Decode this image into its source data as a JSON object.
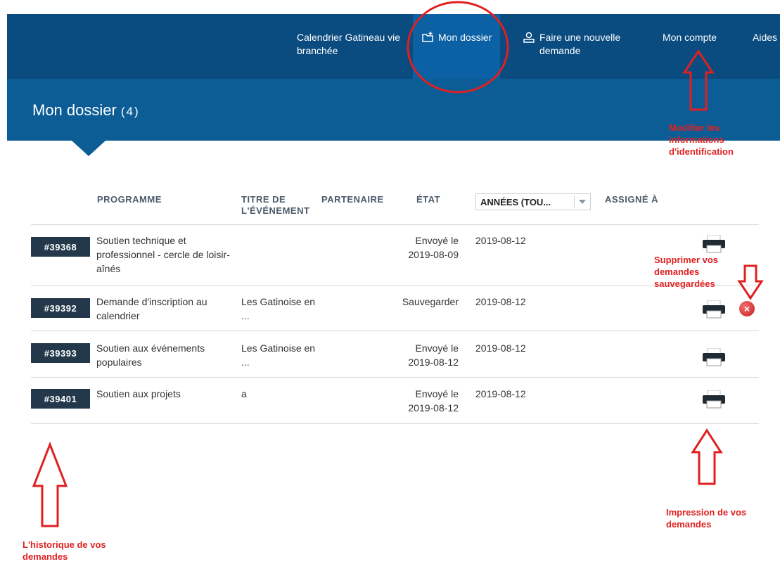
{
  "nav": {
    "calendar_label": "Calendrier Gatineau vie branchée",
    "dossier_label": "Mon dossier",
    "new_request_label": "Faire une nouvelle demande",
    "account_label": "Mon compte",
    "help_label": "Aides"
  },
  "banner": {
    "title": "Mon dossier",
    "count": "(4)"
  },
  "table": {
    "headers": {
      "programme": "PROGRAMME",
      "titre": "TITRE DE L'ÉVÉNEMENT",
      "partenaire": "PARTENAIRE",
      "etat": "ÉTAT",
      "annees": "ANNÉES (TOU...",
      "assigne": "ASSIGNÉ À"
    },
    "rows": [
      {
        "id": "#39368",
        "programme": "Soutien technique et professionnel - cercle de loisir-aînés",
        "partenaire": "",
        "etat": "Envoyé le 2019-08-09",
        "date": "2019-08-12"
      },
      {
        "id": "#39392",
        "programme": "Demande d'inscription au calendrier",
        "partenaire": "Les Gatinoise en ...",
        "etat": "Sauvegarder",
        "date": "2019-08-12"
      },
      {
        "id": "#39393",
        "programme": "Soutien aux événements populaires",
        "partenaire": "Les Gatinoise en ...",
        "etat": "Envoyé le 2019-08-12",
        "date": "2019-08-12"
      },
      {
        "id": "#39401",
        "programme": "Soutien aux projets",
        "partenaire": "a",
        "etat": "Envoyé le 2019-08-12",
        "date": "2019-08-12"
      }
    ]
  },
  "annotations": {
    "account": "Modifier les informations d'identification",
    "delete": "Supprimer vos demandes sauvegardées",
    "print": "Impression de vos demandes",
    "history": "L'historique de vos demandes"
  },
  "colors": {
    "nav_bg": "#0a4b80",
    "banner_bg": "#0c5d96",
    "badge_bg": "#23384a",
    "annotation": "#e02020"
  }
}
